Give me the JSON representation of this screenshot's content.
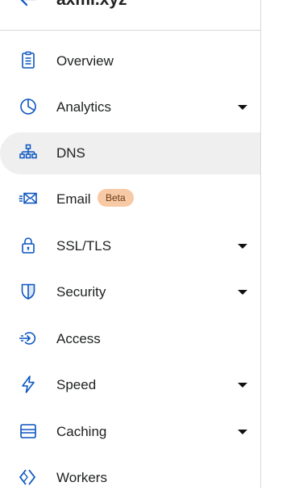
{
  "header": {
    "zone_name": "axmi.xyz"
  },
  "nav": {
    "items": [
      {
        "label": "Overview",
        "icon": "document-icon"
      },
      {
        "label": "Analytics",
        "icon": "pie-chart-icon",
        "expandable": true
      },
      {
        "label": "DNS",
        "icon": "network-tree-icon",
        "active": true
      },
      {
        "label": "Email",
        "icon": "email-icon",
        "badge": "Beta"
      },
      {
        "label": "SSL/TLS",
        "icon": "lock-icon",
        "expandable": true
      },
      {
        "label": "Security",
        "icon": "shield-icon",
        "expandable": true
      },
      {
        "label": "Access",
        "icon": "access-icon"
      },
      {
        "label": "Speed",
        "icon": "lightning-icon",
        "expandable": true
      },
      {
        "label": "Caching",
        "icon": "server-icon",
        "expandable": true
      },
      {
        "label": "Workers",
        "icon": "workers-icon"
      }
    ]
  },
  "colors": {
    "icon": "#0b55c0",
    "active_bg": "#efefef",
    "badge_bg": "#f8c9a5",
    "divider": "#d9d9d9"
  }
}
